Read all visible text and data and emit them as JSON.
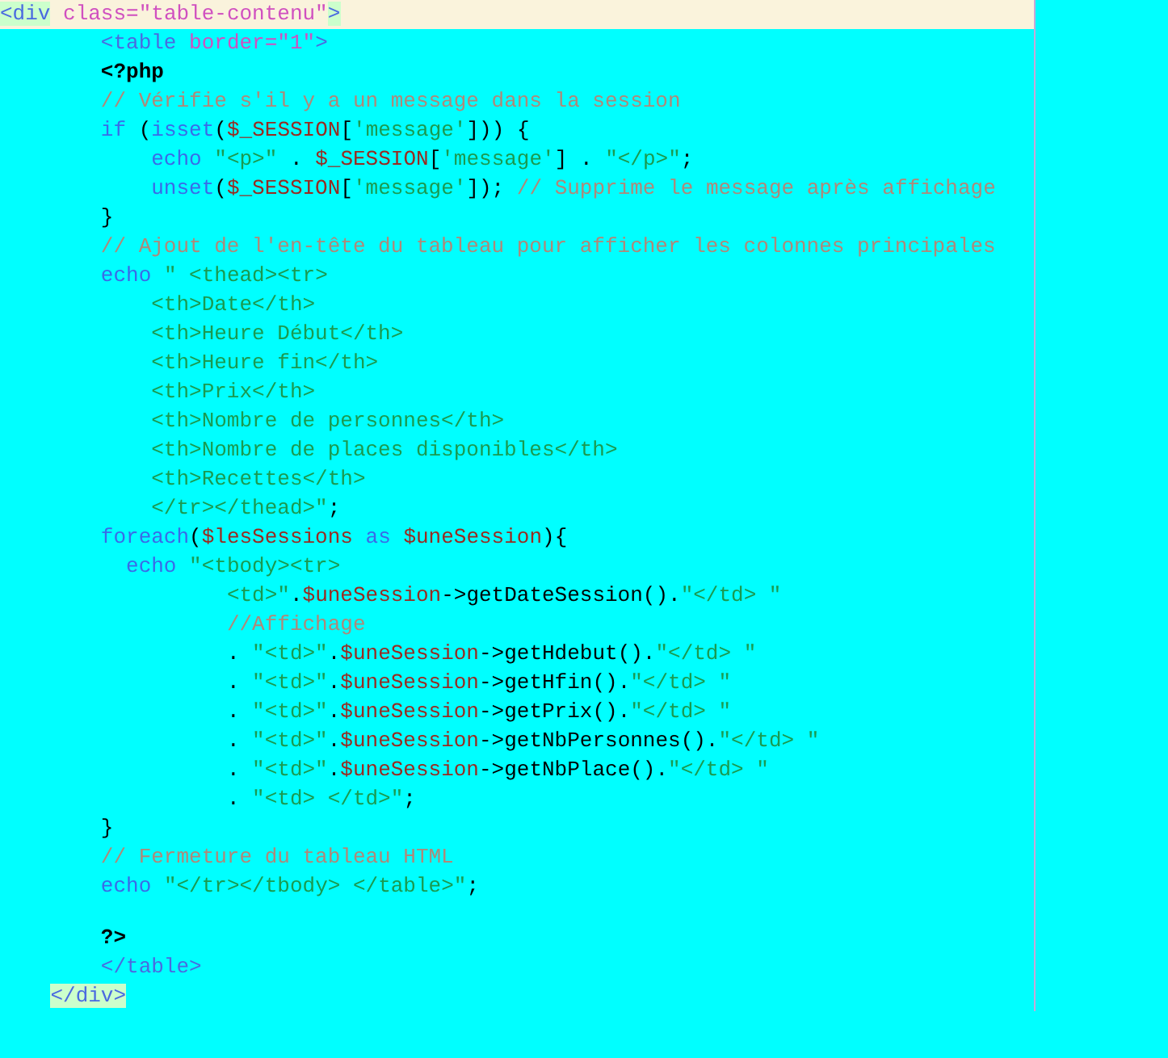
{
  "lines": [
    {
      "current": true,
      "tokens": [
        {
          "kind": "tag-match",
          "text": "<div"
        },
        {
          "kind": "attr",
          "text": " class=\"table-contenu\""
        },
        {
          "kind": "tag-match",
          "text": ">"
        }
      ]
    },
    {
      "current": false,
      "tokens": [
        {
          "kind": "tag",
          "text": "        <table"
        },
        {
          "kind": "attr",
          "text": " border=\"1\""
        },
        {
          "kind": "tag",
          "text": ">"
        }
      ]
    },
    {
      "current": false,
      "tokens": [
        {
          "kind": "php",
          "text": "        <?php"
        }
      ]
    },
    {
      "current": false,
      "tokens": [
        {
          "kind": "comment",
          "text": "        // Vérifie s'il y a un message dans la session"
        }
      ]
    },
    {
      "current": false,
      "tokens": [
        {
          "kind": "keyword",
          "text": "        if"
        },
        {
          "kind": "plain",
          "text": " ("
        },
        {
          "kind": "keyword",
          "text": "isset"
        },
        {
          "kind": "plain",
          "text": "("
        },
        {
          "kind": "var",
          "text": "$_SESSION"
        },
        {
          "kind": "plain",
          "text": "["
        },
        {
          "kind": "string",
          "text": "'message'"
        },
        {
          "kind": "plain",
          "text": "])) {"
        }
      ]
    },
    {
      "current": false,
      "tokens": [
        {
          "kind": "keyword",
          "text": "            echo"
        },
        {
          "kind": "string",
          "text": " \"<p>\""
        },
        {
          "kind": "plain",
          "text": " . "
        },
        {
          "kind": "var",
          "text": "$_SESSION"
        },
        {
          "kind": "plain",
          "text": "["
        },
        {
          "kind": "string",
          "text": "'message'"
        },
        {
          "kind": "plain",
          "text": "] . "
        },
        {
          "kind": "string",
          "text": "\"</p>\""
        },
        {
          "kind": "plain",
          "text": ";"
        }
      ]
    },
    {
      "current": false,
      "tokens": [
        {
          "kind": "keyword",
          "text": "            unset"
        },
        {
          "kind": "plain",
          "text": "("
        },
        {
          "kind": "var",
          "text": "$_SESSION"
        },
        {
          "kind": "plain",
          "text": "["
        },
        {
          "kind": "string",
          "text": "'message'"
        },
        {
          "kind": "plain",
          "text": "]); "
        },
        {
          "kind": "comment",
          "text": "// Supprime le message après affichage"
        }
      ]
    },
    {
      "current": false,
      "tokens": [
        {
          "kind": "plain",
          "text": "        }"
        }
      ]
    },
    {
      "current": false,
      "tokens": [
        {
          "kind": "comment",
          "text": "        // Ajout de l'en-tête du tableau pour afficher les colonnes principales"
        }
      ]
    },
    {
      "current": false,
      "tokens": [
        {
          "kind": "keyword",
          "text": "        echo"
        },
        {
          "kind": "string",
          "text": " \" <thead><tr>"
        }
      ]
    },
    {
      "current": false,
      "tokens": [
        {
          "kind": "string",
          "text": "            <th>Date</th>"
        }
      ]
    },
    {
      "current": false,
      "tokens": [
        {
          "kind": "string",
          "text": "            <th>Heure Début</th>"
        }
      ]
    },
    {
      "current": false,
      "tokens": [
        {
          "kind": "string",
          "text": "            <th>Heure fin</th>"
        }
      ]
    },
    {
      "current": false,
      "tokens": [
        {
          "kind": "string",
          "text": "            <th>Prix</th>"
        }
      ]
    },
    {
      "current": false,
      "tokens": [
        {
          "kind": "string",
          "text": "            <th>Nombre de personnes</th>"
        }
      ]
    },
    {
      "current": false,
      "tokens": [
        {
          "kind": "string",
          "text": "            <th>Nombre de places disponibles</th>"
        }
      ]
    },
    {
      "current": false,
      "tokens": [
        {
          "kind": "string",
          "text": "            <th>Recettes</th>"
        }
      ]
    },
    {
      "current": false,
      "tokens": [
        {
          "kind": "string",
          "text": "            </tr></thead>\""
        },
        {
          "kind": "plain",
          "text": ";"
        }
      ]
    },
    {
      "current": false,
      "tokens": [
        {
          "kind": "keyword",
          "text": "        foreach"
        },
        {
          "kind": "plain",
          "text": "("
        },
        {
          "kind": "var",
          "text": "$lesSessions"
        },
        {
          "kind": "keyword",
          "text": " as "
        },
        {
          "kind": "var",
          "text": "$uneSession"
        },
        {
          "kind": "plain",
          "text": "){"
        }
      ]
    },
    {
      "current": false,
      "tokens": [
        {
          "kind": "keyword",
          "text": "          echo"
        },
        {
          "kind": "string",
          "text": " \"<tbody><tr>"
        }
      ]
    },
    {
      "current": false,
      "tokens": [
        {
          "kind": "string",
          "text": "                  <td>\""
        },
        {
          "kind": "plain",
          "text": "."
        },
        {
          "kind": "var",
          "text": "$uneSession"
        },
        {
          "kind": "plain",
          "text": "->getDateSession()."
        },
        {
          "kind": "string",
          "text": "\"</td> \""
        }
      ]
    },
    {
      "current": false,
      "tokens": [
        {
          "kind": "comment",
          "text": "                  //Affichage"
        }
      ]
    },
    {
      "current": false,
      "tokens": [
        {
          "kind": "plain",
          "text": "                  . "
        },
        {
          "kind": "string",
          "text": "\"<td>\""
        },
        {
          "kind": "plain",
          "text": "."
        },
        {
          "kind": "var",
          "text": "$uneSession"
        },
        {
          "kind": "plain",
          "text": "->getHdebut()."
        },
        {
          "kind": "string",
          "text": "\"</td> \""
        }
      ]
    },
    {
      "current": false,
      "tokens": [
        {
          "kind": "plain",
          "text": "                  . "
        },
        {
          "kind": "string",
          "text": "\"<td>\""
        },
        {
          "kind": "plain",
          "text": "."
        },
        {
          "kind": "var",
          "text": "$uneSession"
        },
        {
          "kind": "plain",
          "text": "->getHfin()."
        },
        {
          "kind": "string",
          "text": "\"</td> \""
        }
      ]
    },
    {
      "current": false,
      "tokens": [
        {
          "kind": "plain",
          "text": "                  . "
        },
        {
          "kind": "string",
          "text": "\"<td>\""
        },
        {
          "kind": "plain",
          "text": "."
        },
        {
          "kind": "var",
          "text": "$uneSession"
        },
        {
          "kind": "plain",
          "text": "->getPrix()."
        },
        {
          "kind": "string",
          "text": "\"</td> \""
        }
      ]
    },
    {
      "current": false,
      "tokens": [
        {
          "kind": "plain",
          "text": "                  . "
        },
        {
          "kind": "string",
          "text": "\"<td>\""
        },
        {
          "kind": "plain",
          "text": "."
        },
        {
          "kind": "var",
          "text": "$uneSession"
        },
        {
          "kind": "plain",
          "text": "->getNbPersonnes()."
        },
        {
          "kind": "string",
          "text": "\"</td> \""
        }
      ]
    },
    {
      "current": false,
      "tokens": [
        {
          "kind": "plain",
          "text": "                  . "
        },
        {
          "kind": "string",
          "text": "\"<td>\""
        },
        {
          "kind": "plain",
          "text": "."
        },
        {
          "kind": "var",
          "text": "$uneSession"
        },
        {
          "kind": "plain",
          "text": "->getNbPlace()."
        },
        {
          "kind": "string",
          "text": "\"</td> \""
        }
      ]
    },
    {
      "current": false,
      "tokens": [
        {
          "kind": "plain",
          "text": "                  . "
        },
        {
          "kind": "string",
          "text": "\"<td> </td>\""
        },
        {
          "kind": "plain",
          "text": ";"
        }
      ]
    },
    {
      "current": false,
      "tokens": [
        {
          "kind": "plain",
          "text": "        }"
        }
      ]
    },
    {
      "current": false,
      "tokens": [
        {
          "kind": "comment",
          "text": "        // Fermeture du tableau HTML"
        }
      ]
    },
    {
      "current": false,
      "tokens": [
        {
          "kind": "keyword",
          "text": "        echo"
        },
        {
          "kind": "string",
          "text": " \"</tr></tbody> </table>\""
        },
        {
          "kind": "plain",
          "text": ";"
        }
      ]
    },
    {
      "current": false
    },
    {
      "current": false,
      "tokens": [
        {
          "kind": "php",
          "text": "        ?>"
        }
      ]
    },
    {
      "current": false,
      "tokens": [
        {
          "kind": "tag",
          "text": "        </table>"
        }
      ]
    },
    {
      "current": false,
      "tokens": [
        {
          "kind": "tag-match",
          "text": "    </div>"
        }
      ]
    }
  ]
}
